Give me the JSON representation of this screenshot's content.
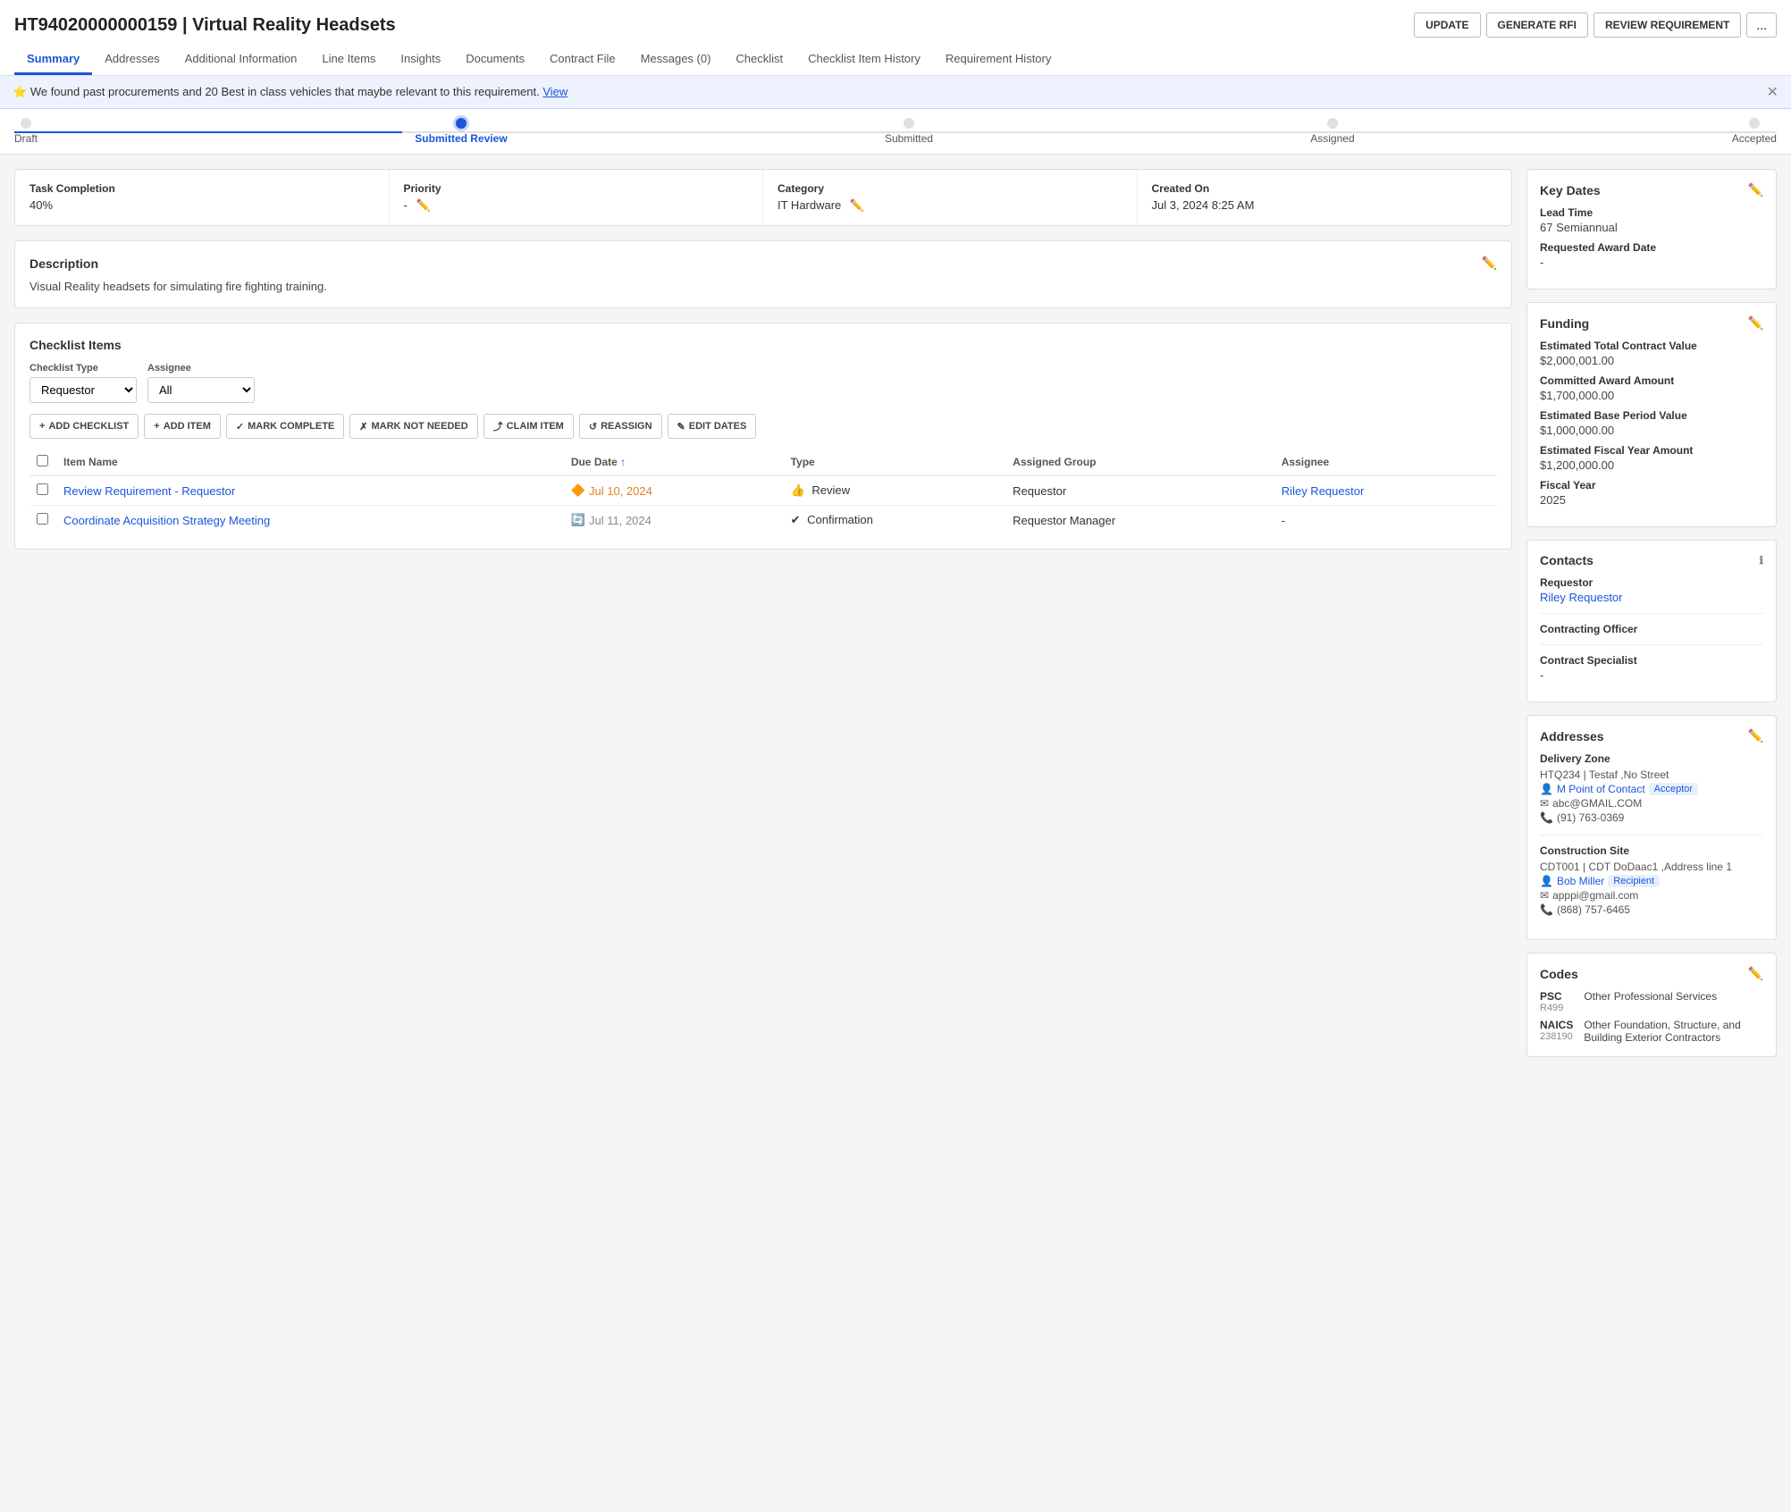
{
  "header": {
    "id": "HT94020000000159",
    "title": "Virtual Reality Headsets",
    "full_title": "HT94020000000159 | Virtual Reality Headsets",
    "actions": {
      "update": "UPDATE",
      "generate_rfi": "GENERATE RFI",
      "review_requirement": "REVIEW REQUIREMENT",
      "more": "..."
    }
  },
  "nav": {
    "tabs": [
      {
        "label": "Summary",
        "active": true
      },
      {
        "label": "Addresses"
      },
      {
        "label": "Additional Information"
      },
      {
        "label": "Line Items"
      },
      {
        "label": "Insights"
      },
      {
        "label": "Documents"
      },
      {
        "label": "Contract File"
      },
      {
        "label": "Messages (0)"
      },
      {
        "label": "Checklist"
      },
      {
        "label": "Checklist Item History"
      },
      {
        "label": "Requirement History"
      }
    ]
  },
  "alert": {
    "text": "We found past procurements and 20 Best in class vehicles that maybe relevant to this requirement.",
    "link": "View"
  },
  "progress": {
    "steps": [
      "Draft",
      "Submitted Review",
      "Submitted",
      "Assigned",
      "Accepted"
    ],
    "current": 1
  },
  "summary_cards": [
    {
      "label": "Task Completion",
      "value": "40%",
      "editable": false
    },
    {
      "label": "Priority",
      "value": "-",
      "editable": true
    },
    {
      "label": "Category",
      "value": "IT Hardware",
      "editable": true
    },
    {
      "label": "Created On",
      "value": "Jul 3, 2024 8:25 AM",
      "editable": false
    }
  ],
  "description": {
    "title": "Description",
    "text": "Visual Reality headsets for simulating fire fighting training.",
    "editable": true
  },
  "checklist": {
    "title": "Checklist Items",
    "filters": {
      "type_label": "Checklist Type",
      "type_value": "Requestor",
      "assignee_label": "Assignee",
      "assignee_value": "All"
    },
    "actions": [
      {
        "label": "ADD CHECKLIST",
        "icon": "+",
        "disabled": false
      },
      {
        "label": "ADD ITEM",
        "icon": "+",
        "disabled": false
      },
      {
        "label": "MARK COMPLETE",
        "icon": "✓",
        "disabled": false
      },
      {
        "label": "MARK NOT NEEDED",
        "icon": "✗",
        "disabled": false
      },
      {
        "label": "CLAIM ITEM",
        "icon": "⤴",
        "disabled": false
      },
      {
        "label": "REASSIGN",
        "icon": "↺",
        "disabled": false
      },
      {
        "label": "EDIT DATES",
        "icon": "✎",
        "disabled": false
      }
    ],
    "columns": [
      "",
      "Item Name",
      "Due Date",
      "Type",
      "Assigned Group",
      "Assignee"
    ],
    "items": [
      {
        "name": "Review Requirement - Requestor",
        "due_date": "Jul 10, 2024",
        "due_date_status": "orange",
        "type": "Review",
        "type_icon": "👍",
        "assigned_group": "Requestor",
        "assignee": "Riley Requestor",
        "assignee_link": true
      },
      {
        "name": "Coordinate Acquisition Strategy Meeting",
        "due_date": "Jul 11, 2024",
        "due_date_status": "gray",
        "type": "Confirmation",
        "type_icon": "✔",
        "assigned_group": "Requestor Manager",
        "assignee": "-",
        "assignee_link": false
      }
    ]
  },
  "key_dates": {
    "title": "Key Dates",
    "lead_time_label": "Lead Time",
    "lead_time_value": "67 Semiannual",
    "requested_award_label": "Requested Award Date",
    "requested_award_value": "-"
  },
  "funding": {
    "title": "Funding",
    "fields": [
      {
        "label": "Estimated Total Contract Value",
        "value": "$2,000,001.00"
      },
      {
        "label": "Committed Award Amount",
        "value": "$1,700,000.00"
      },
      {
        "label": "Estimated Base Period Value",
        "value": "$1,000,000.00"
      },
      {
        "label": "Estimated Fiscal Year Amount",
        "value": "$1,200,000.00"
      },
      {
        "label": "Fiscal Year",
        "value": "2025"
      }
    ]
  },
  "contacts": {
    "title": "Contacts",
    "requestor_label": "Requestor",
    "requestor_value": "Riley Requestor",
    "contracting_officer_label": "Contracting Officer",
    "contracting_officer_value": "",
    "contract_specialist_label": "Contract Specialist",
    "contract_specialist_value": "-"
  },
  "addresses": {
    "title": "Addresses",
    "delivery_zone": {
      "title": "Delivery Zone",
      "address": "HTQ234 | Testaf ,No Street",
      "contact": "M Point of Contact",
      "contact_role": "Acceptor",
      "email": "abc@GMAIL.COM",
      "phone": "(91) 763-0369"
    },
    "construction_site": {
      "title": "Construction Site",
      "address": "CDT001 | CDT DoDaac1 ,Address line 1",
      "contact": "Bob Miller",
      "contact_role": "Recipient",
      "email": "apppi@gmail.com",
      "phone": "(868) 757-6465"
    }
  },
  "codes": {
    "title": "Codes",
    "items": [
      {
        "key": "PSC",
        "subkey": "R499",
        "value": "Other Professional Services"
      },
      {
        "key": "NAICS",
        "subkey": "238190",
        "value": "Other Foundation, Structure, and Building Exterior Contractors"
      }
    ]
  }
}
